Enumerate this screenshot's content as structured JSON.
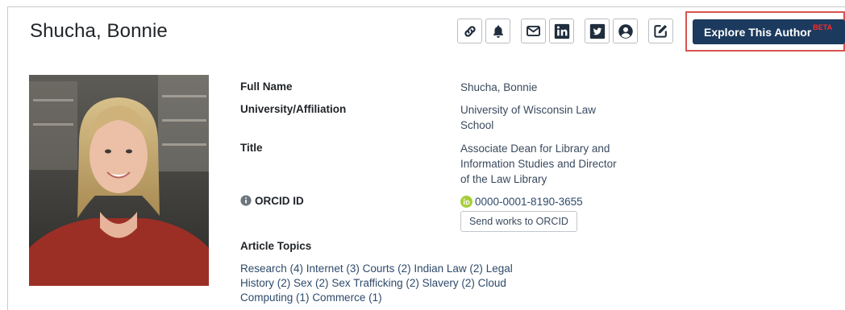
{
  "author": {
    "name": "Shucha, Bonnie"
  },
  "toolbar": {
    "icons": [
      "link-icon",
      "bell-icon",
      "envelope-icon",
      "linkedin-icon",
      "twitter-icon",
      "user-circle-icon",
      "edit-icon"
    ],
    "explore_label": "Explore This Author",
    "beta_label": "BETA"
  },
  "details": {
    "full_name_label": "Full Name",
    "full_name_value": "Shucha, Bonnie",
    "affiliation_label": "University/Affiliation",
    "affiliation_value": "University of Wisconsin Law School",
    "title_label": "Title",
    "title_value": "Associate Dean for Library and Information Studies and Director of the Law Library",
    "orcid_label": "ORCID ID",
    "orcid_value": "0000-0001-8190-3655",
    "orcid_button": "Send works to ORCID",
    "topics_label": "Article Topics"
  },
  "topics": [
    "Research (4)",
    "Internet (3)",
    "Courts (2)",
    "Indian Law (2)",
    "Legal History (2)",
    "Sex (2)",
    "Sex Trafficking (2)",
    "Slavery (2)",
    "Cloud Computing (1)",
    "Commerce (1)"
  ],
  "colors": {
    "explore_bg": "#1c3a5e",
    "highlight_border": "#d9534f",
    "beta": "#ff2b2b",
    "orcid_green": "#a6ce39",
    "link": "#2e4a6b"
  }
}
